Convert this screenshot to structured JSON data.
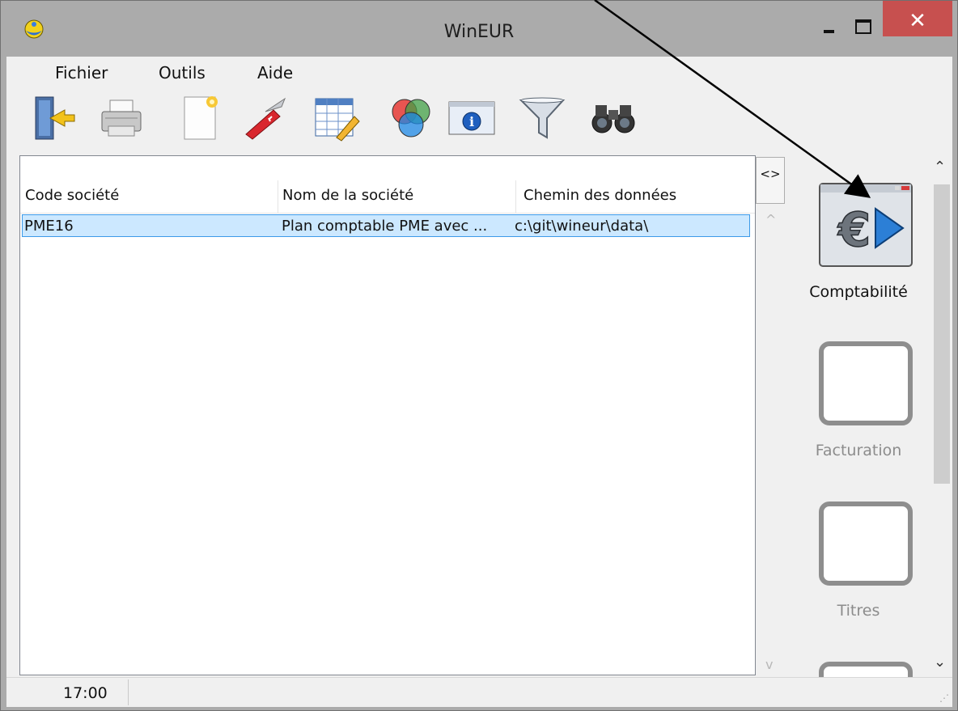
{
  "window": {
    "title": "WinEUR",
    "close_glyph": "✕"
  },
  "menu": {
    "items": [
      {
        "label": "Fichier"
      },
      {
        "label": "Outils"
      },
      {
        "label": "Aide"
      }
    ]
  },
  "toolbar": {
    "buttons": [
      {
        "icon": "exit-door-icon"
      },
      {
        "icon": "printer-icon"
      },
      {
        "icon": "new-document-icon"
      },
      {
        "icon": "swiss-knife-icon"
      },
      {
        "icon": "spreadsheet-edit-icon"
      },
      {
        "icon": "color-circles-icon"
      },
      {
        "icon": "info-window-icon"
      },
      {
        "icon": "funnel-filter-icon"
      },
      {
        "icon": "binoculars-icon"
      }
    ]
  },
  "list": {
    "columns": [
      {
        "label": "Code société"
      },
      {
        "label": "Nom de la société"
      },
      {
        "label": "Chemin des données"
      }
    ],
    "rows": [
      {
        "code": "PME16",
        "name": "Plan comptable PME avec ...",
        "path": "c:\\git\\wineur\\data\\"
      }
    ]
  },
  "panel_toggle": {
    "label": "<>"
  },
  "modules": [
    {
      "label": "Comptabilité",
      "enabled": true,
      "icon": "euro-play-icon"
    },
    {
      "label": "Facturation",
      "enabled": false,
      "icon": "blank-module-icon"
    },
    {
      "label": "Titres",
      "enabled": false,
      "icon": "blank-module-icon"
    }
  ],
  "statusbar": {
    "time": "17:00"
  },
  "colors": {
    "close_button": "#c7504f",
    "title_bar": "#ababab",
    "selection": "#cce8ff",
    "selection_border": "#3c9ae8",
    "disabled_text": "#8c8c8c"
  }
}
